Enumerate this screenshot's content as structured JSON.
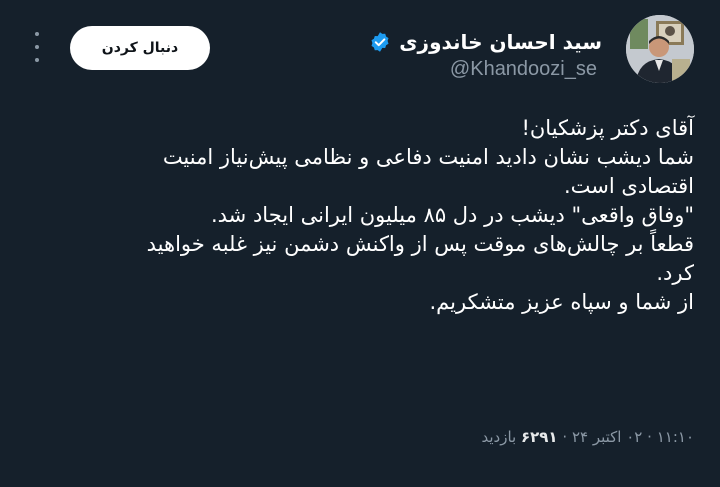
{
  "author": {
    "display_name": "سید احسان خاندوزی",
    "handle": "@Khandoozi_se",
    "verified": true,
    "verified_color": "#1d9bf0"
  },
  "actions": {
    "follow_label": "دنبال کردن",
    "more_icon": "more-vertical-icon"
  },
  "tweet": {
    "lines": [
      "آقای دکتر پزشکیان!",
      "شما دیشب نشان دادید امنیت دفاعی و نظامی پیش‌نیاز امنیت",
      "اقتصادی است.",
      "\"وفاق واقعی\" دیشب در دل ۸۵ میلیون ایرانی ایجاد شد.",
      "قطعاً بر چالش‌های موقت پس از واکنش دشمن نیز غلبه خواهید",
      "کرد.",
      "از شما و سپاه عزیز متشکریم."
    ]
  },
  "meta": {
    "time": "۱۱:۱۰",
    "date": "۰۲ اکتبر ۲۴",
    "views_count": "۶۲۹۱",
    "views_label": "بازدید",
    "separator": "·"
  },
  "colors": {
    "background": "#15202b",
    "text": "#ffffff",
    "secondary_text": "#8b98a5"
  }
}
